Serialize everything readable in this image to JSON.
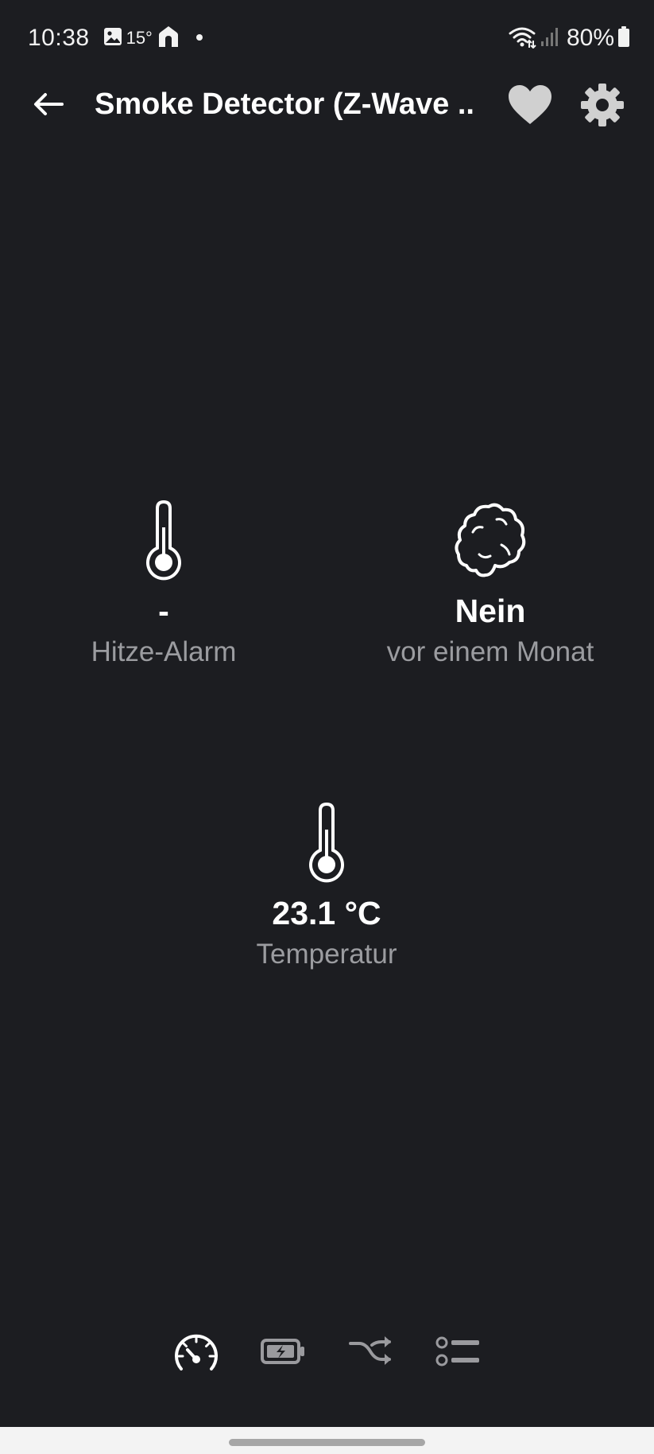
{
  "status_bar": {
    "time": "10:38",
    "temperature": "15°",
    "battery": "80%",
    "icons": [
      "image-icon",
      "home-icon",
      "dot-icon",
      "wifi-icon",
      "signal-icon",
      "battery-icon"
    ]
  },
  "app_bar": {
    "title": "Smoke Detector (Z-Wave ...",
    "icons": [
      "back-arrow-icon",
      "heart-icon",
      "gear-icon"
    ]
  },
  "tiles": {
    "heat_alarm": {
      "value": "-",
      "label": "Hitze-Alarm",
      "icon": "thermometer-icon"
    },
    "smoke": {
      "value": "Nein",
      "label": "vor einem Monat",
      "icon": "smoke-icon"
    },
    "temperature": {
      "value": "23.1 °C",
      "label": "Temperatur",
      "icon": "thermometer-icon"
    }
  },
  "bottom_nav": {
    "items": [
      "speedometer-icon",
      "battery-charging-icon",
      "shuffle-icon",
      "list-icon"
    ],
    "active_index": 0
  },
  "colors": {
    "background": "#1c1d21",
    "text_primary": "#ffffff",
    "text_secondary": "#9b9ca0",
    "icon_muted": "#9a9a9e",
    "gesture_bar": "#f3f3f3"
  }
}
